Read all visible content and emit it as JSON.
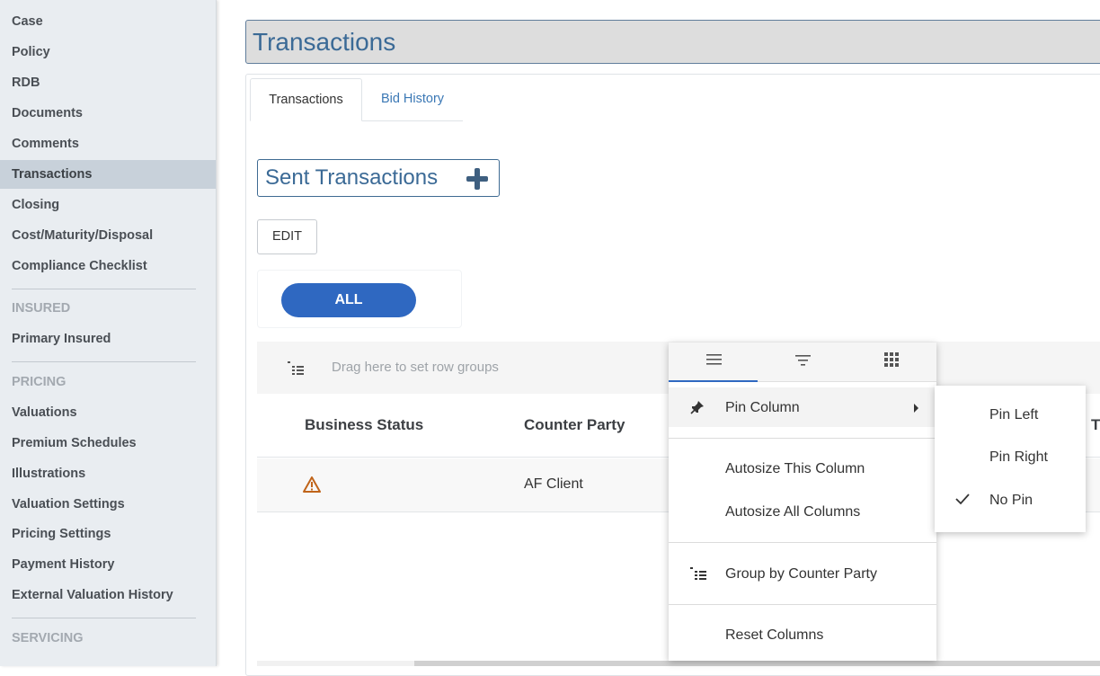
{
  "sidebar": {
    "items": [
      {
        "label": "Case"
      },
      {
        "label": "Policy"
      },
      {
        "label": "RDB"
      },
      {
        "label": "Documents"
      },
      {
        "label": "Comments"
      },
      {
        "label": "Transactions"
      },
      {
        "label": "Closing"
      },
      {
        "label": "Cost/Maturity/Disposal"
      },
      {
        "label": "Compliance Checklist"
      }
    ],
    "insured_section": "INSURED",
    "insured_items": [
      {
        "label": "Primary Insured"
      }
    ],
    "pricing_section": "PRICING",
    "pricing_items": [
      {
        "label": "Valuations"
      },
      {
        "label": "Premium Schedules"
      },
      {
        "label": "Illustrations"
      },
      {
        "label": "Valuation Settings"
      },
      {
        "label": "Pricing Settings"
      },
      {
        "label": "Payment History"
      },
      {
        "label": "External Valuation History"
      }
    ],
    "servicing_section": "SERVICING",
    "active_item": "Transactions"
  },
  "page": {
    "title": "Transactions",
    "tabs": [
      {
        "label": "Transactions"
      },
      {
        "label": "Bid History"
      }
    ],
    "sent_title": "Sent Transactions",
    "edit_label": "EDIT",
    "all_label": "ALL"
  },
  "grid": {
    "group_placeholder": "Drag here to set row groups",
    "columns": [
      "Business Status",
      "Counter Party"
    ],
    "clipped_column_initial": "T",
    "rows": [
      {
        "business_status_icon": "warning-triangle-icon",
        "counter_party": "AF Client"
      }
    ]
  },
  "column_menu": {
    "tab_icons": [
      "menu-lines-icon",
      "filter-icon",
      "columns-grid-icon"
    ],
    "items": {
      "pin_column": "Pin Column",
      "autosize_this": "Autosize This Column",
      "autosize_all": "Autosize All Columns",
      "group_by": "Group by Counter Party",
      "reset": "Reset Columns"
    },
    "pin_submenu": {
      "options": [
        "Pin Left",
        "Pin Right",
        "No Pin"
      ],
      "selected": "No Pin"
    }
  },
  "colors": {
    "accent": "#2f68c1",
    "title_blue": "#3b6a96",
    "warning": "#c0641a"
  }
}
